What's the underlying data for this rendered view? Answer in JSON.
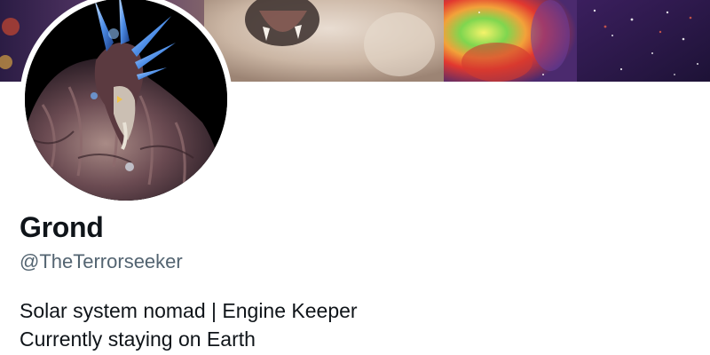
{
  "profile": {
    "display_name": "Grond",
    "handle": "@TheTerrorseeker",
    "bio_lines": [
      "Solar system nomad | Engine Keeper",
      "Currently staying on Earth"
    ]
  },
  "header_image": {
    "icon": "banner-image"
  },
  "avatar": {
    "icon": "avatar-image"
  },
  "colors": {
    "text_primary": "#0f1419",
    "text_secondary": "#536471",
    "background": "#ffffff"
  }
}
